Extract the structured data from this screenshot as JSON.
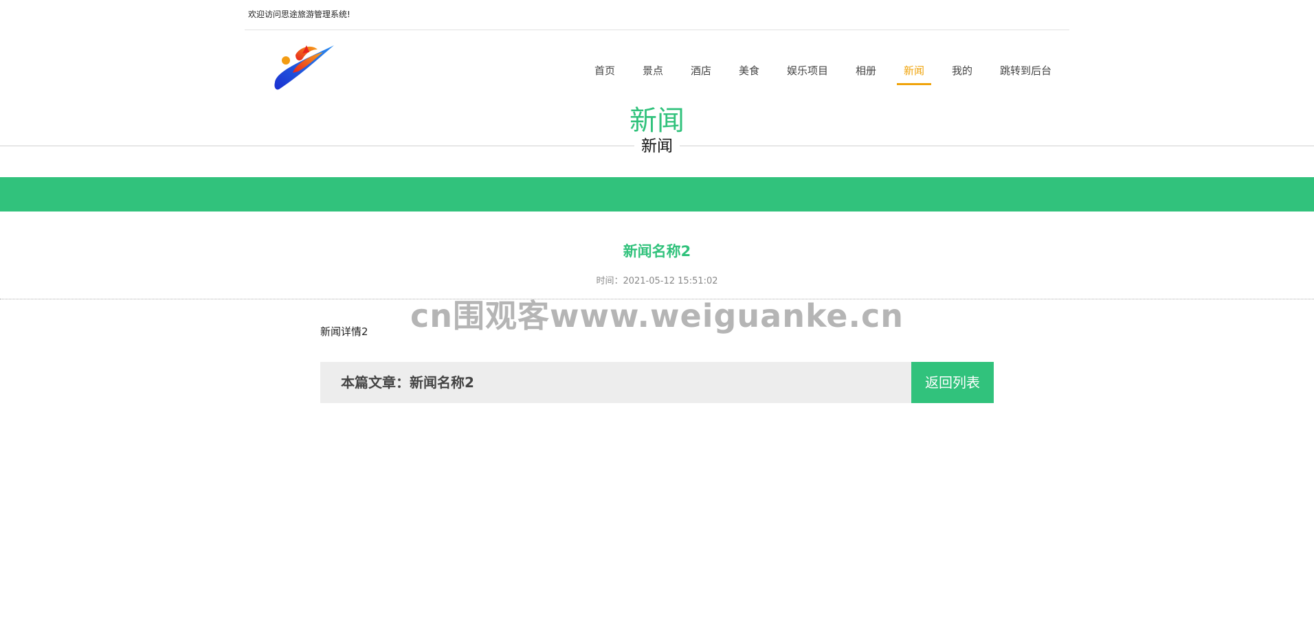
{
  "header": {
    "welcome_text": "欢迎访问思途旅游管理系统!"
  },
  "nav": {
    "items": [
      {
        "label": "首页",
        "active": false
      },
      {
        "label": "景点",
        "active": false
      },
      {
        "label": "酒店",
        "active": false
      },
      {
        "label": "美食",
        "active": false
      },
      {
        "label": "娱乐项目",
        "active": false
      },
      {
        "label": "相册",
        "active": false
      },
      {
        "label": "新闻",
        "active": true
      },
      {
        "label": "我的",
        "active": false
      },
      {
        "label": "跳转到后台",
        "active": false
      }
    ]
  },
  "section": {
    "title": "新闻",
    "subtitle": "新闻"
  },
  "news": {
    "title": "新闻名称2",
    "time_label": "时间：",
    "time_value": "2021-05-12 15:51:02",
    "body": "新闻详情2"
  },
  "article_bar": {
    "label": "本篇文章：新闻名称2",
    "back_label": "返回列表"
  },
  "watermark": {
    "text": "cn围观客www.weiguanke.cn"
  },
  "colors": {
    "accent": "#31c27c",
    "nav_active": "#f0a30a"
  },
  "icons": {
    "logo": "brand-logo"
  }
}
